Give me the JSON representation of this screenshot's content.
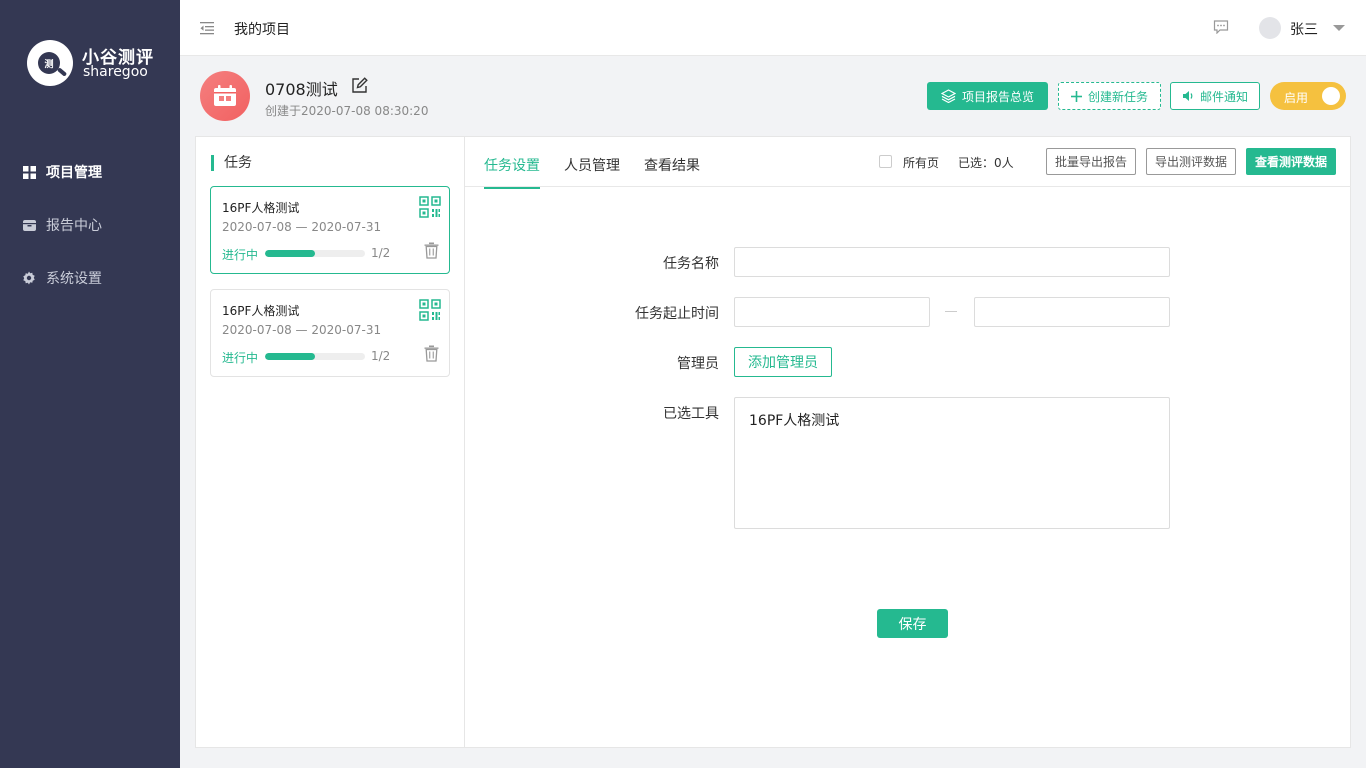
{
  "brand": {
    "name_cn": "小谷测评",
    "name_en": "sharegoo",
    "logo_glyph": "测"
  },
  "sidebar": {
    "items": [
      {
        "label": "项目管理",
        "icon": "grid-icon",
        "active": true
      },
      {
        "label": "报告中心",
        "icon": "box-icon",
        "active": false
      },
      {
        "label": "系统设置",
        "icon": "gear-icon",
        "active": false
      }
    ]
  },
  "topbar": {
    "title": "我的项目",
    "user": "张三"
  },
  "project": {
    "name": "0708测试",
    "created": "创建于2020-07-08  08:30:20",
    "actions": {
      "report_overview": "项目报告总览",
      "create_task": "创建新任务",
      "mail_notify": "邮件通知",
      "toggle_label": "启用"
    }
  },
  "tasks": {
    "heading": "任务",
    "items": [
      {
        "name": "16PF人格测试",
        "dates": "2020-07-08  —  2020-07-31",
        "status": "进行中",
        "progress": 0.5,
        "count": "1/2",
        "active": true
      },
      {
        "name": "16PF人格测试",
        "dates": "2020-07-08  —  2020-07-31",
        "status": "进行中",
        "progress": 0.5,
        "count": "1/2",
        "active": false
      }
    ]
  },
  "tabs": [
    {
      "label": "任务设置",
      "active": true
    },
    {
      "label": "人员管理",
      "active": false
    },
    {
      "label": "查看结果",
      "active": false
    }
  ],
  "toolbar": {
    "all_pages": "所有页",
    "selected": "已选：0人",
    "batch_export": "批量导出报告",
    "export_data": "导出测评数据",
    "view_data": "查看测评数据"
  },
  "form": {
    "task_name_label": "任务名称",
    "task_name_value": "",
    "time_label": "任务起止时间",
    "start_value": "",
    "end_value": "",
    "admin_label": "管理员",
    "add_admin": "添加管理员",
    "tools_label": "已选工具",
    "tools": [
      "16PF人格测试"
    ],
    "save": "保存"
  },
  "colors": {
    "accent": "#25b990",
    "sidebar": "#343853",
    "toggle": "#f5c13f",
    "project_icon": "#f26161"
  }
}
